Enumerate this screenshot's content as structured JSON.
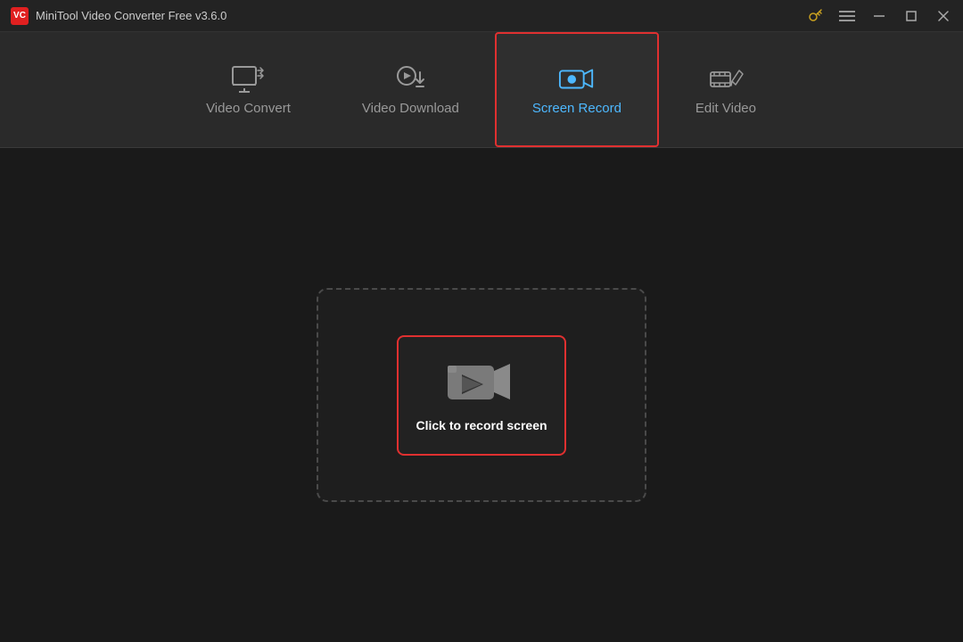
{
  "app": {
    "title": "MiniTool Video Converter Free v3.6.0",
    "logo_text": "VC"
  },
  "titlebar": {
    "key_icon": "key-icon",
    "menu_icon": "menu-icon",
    "minimize_icon": "minimize-icon",
    "maximize_icon": "maximize-icon",
    "close_icon": "close-icon"
  },
  "nav": {
    "items": [
      {
        "id": "video-convert",
        "label": "Video Convert",
        "active": false
      },
      {
        "id": "video-download",
        "label": "Video Download",
        "active": false
      },
      {
        "id": "screen-record",
        "label": "Screen Record",
        "active": true
      },
      {
        "id": "edit-video",
        "label": "Edit Video",
        "active": false
      }
    ]
  },
  "main": {
    "record_button_label": "Click to record screen"
  }
}
